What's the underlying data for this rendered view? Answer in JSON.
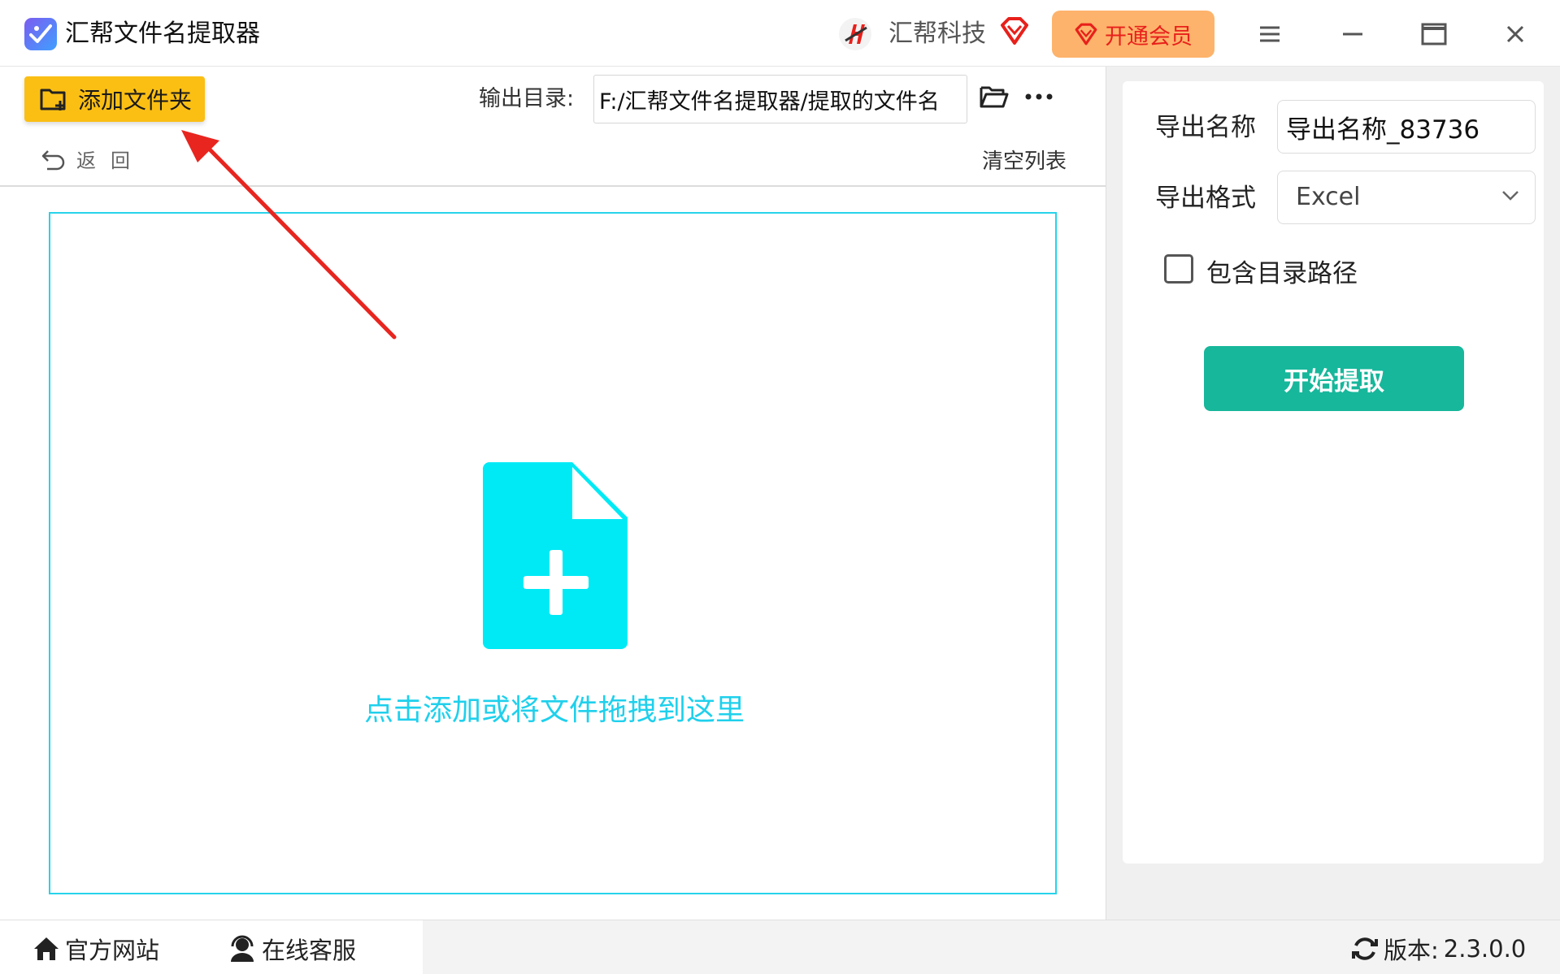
{
  "titlebar": {
    "app_title": "汇帮文件名提取器",
    "brand_name": "汇帮科技",
    "vip_label": "开通会员"
  },
  "toolbar": {
    "add_folder_label": "添加文件夹",
    "output_label": "输出目录:",
    "output_path": "F:/汇帮文件名提取器/提取的文件名",
    "back_label": "返回",
    "clear_label": "清空列表"
  },
  "dropzone": {
    "hint": "点击添加或将文件拖拽到这里"
  },
  "settings": {
    "export_name_label": "导出名称",
    "export_name_value": "导出名称_83736",
    "export_format_label": "导出格式",
    "export_format_value": "Excel",
    "include_path_label": "包含目录路径",
    "include_path_checked": false,
    "start_label": "开始提取"
  },
  "footer": {
    "website_label": "官方网站",
    "support_label": "在线客服",
    "version_label": "版本:",
    "version_value": "2.3.0.0"
  },
  "colors": {
    "accent_yellow": "#fbbf14",
    "dropzone_cyan": "#00eaf6",
    "start_green": "#17b79b",
    "vip_orange": "#fdb36b",
    "annotation_red": "#e8251f"
  },
  "icons": {
    "app_logo": "app-logo-icon",
    "vip": "diamond-icon",
    "folder_open": "folder-open-icon",
    "more": "more-dots-icon",
    "back": "undo-arrow-icon",
    "drop": "add-file-icon",
    "home": "home-icon",
    "support": "headset-icon",
    "refresh": "refresh-icon"
  }
}
